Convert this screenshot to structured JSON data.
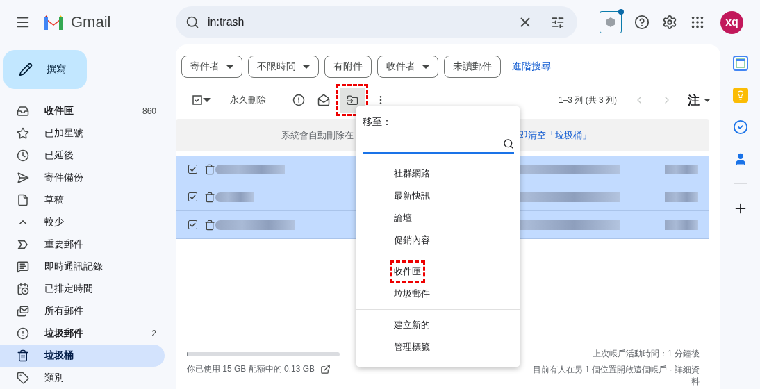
{
  "app": {
    "name": "Gmail"
  },
  "search": {
    "value": "in:trash"
  },
  "account": {
    "initials": "xq"
  },
  "compose": {
    "label": "撰寫"
  },
  "nav": [
    {
      "label": "收件匣",
      "count": "860",
      "unread": true,
      "selected": false
    },
    {
      "label": "已加星號",
      "unread": false,
      "selected": false
    },
    {
      "label": "已延後",
      "unread": false,
      "selected": false
    },
    {
      "label": "寄件備份",
      "unread": false,
      "selected": false
    },
    {
      "label": "草稿",
      "unread": false,
      "selected": false
    },
    {
      "label": "較少",
      "unread": false,
      "selected": false
    },
    {
      "label": "重要郵件",
      "unread": false,
      "selected": false
    },
    {
      "label": "即時通訊記錄",
      "unread": false,
      "selected": false
    },
    {
      "label": "已排定時間",
      "unread": false,
      "selected": false
    },
    {
      "label": "所有郵件",
      "unread": false,
      "selected": false
    },
    {
      "label": "垃圾郵件",
      "count": "2",
      "unread": true,
      "selected": false
    },
    {
      "label": "垃圾桶",
      "unread": true,
      "selected": true
    },
    {
      "label": "類別",
      "unread": false,
      "selected": false
    }
  ],
  "filters": [
    {
      "label": "寄件者",
      "dropdown": true
    },
    {
      "label": "不限時間",
      "dropdown": true
    },
    {
      "label": "有附件",
      "dropdown": false
    },
    {
      "label": "收件者",
      "dropdown": true
    },
    {
      "label": "未讀郵件",
      "dropdown": false
    }
  ],
  "advanced_search": "進階搜尋",
  "toolbar": {
    "select_all_checked": true,
    "delete_forever": "永久刪除",
    "move_highlighted": true,
    "range": "1–3 列 (共 3 列)",
    "input_tool": "注"
  },
  "notice": {
    "text": "系統會自動刪除在",
    "link": "即清空「垃圾桶」"
  },
  "rows": [
    {
      "checked": true,
      "selected": true
    },
    {
      "checked": true,
      "selected": true
    },
    {
      "checked": true,
      "selected": true
    }
  ],
  "move_menu": {
    "title": "移至：",
    "groups": [
      [
        {
          "label": "社群網路",
          "highlighted": false
        },
        {
          "label": "最新快訊",
          "highlighted": false
        },
        {
          "label": "論壇",
          "highlighted": false
        },
        {
          "label": "促銷內容",
          "highlighted": false
        }
      ],
      [
        {
          "label": "收件匣",
          "highlighted": true
        },
        {
          "label": "垃圾郵件",
          "highlighted": false
        }
      ],
      [
        {
          "label": "建立新的",
          "highlighted": false
        },
        {
          "label": "管理標籤",
          "highlighted": false
        }
      ]
    ]
  },
  "footer": {
    "storage": "你已使用 15 GB 配額中的 0.13 GB",
    "storage_level": {
      "level": 0.01
    },
    "last_activity": "上次帳戶活動時間：1 分鐘後",
    "other_location": "目前有人在另 1 個位置開啟這個帳戶 · 詳細資料"
  }
}
